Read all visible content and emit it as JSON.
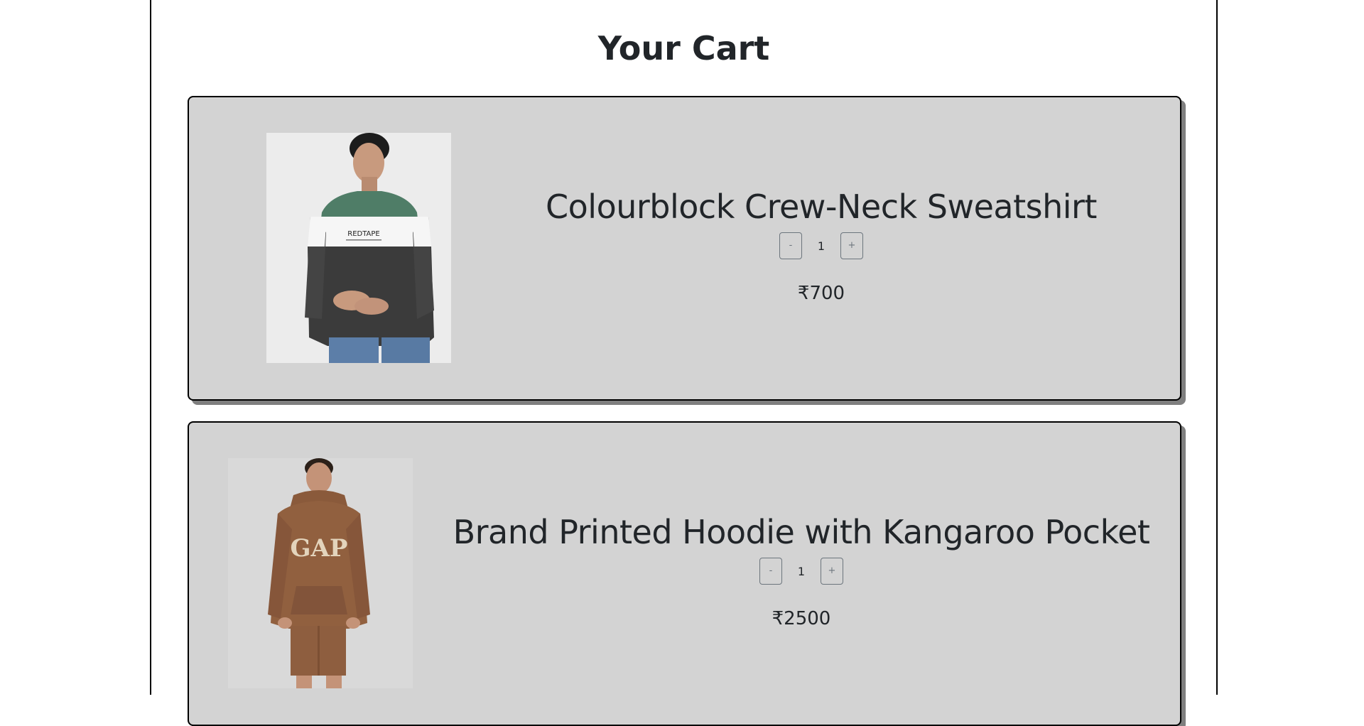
{
  "page": {
    "title": "Your Cart"
  },
  "cart": {
    "items": [
      {
        "name": "Colourblock Crew-Neck Sweatshirt",
        "image_icon": "sweatshirt-product-photo",
        "image_logo_text": "REDTAPE",
        "decrement_label": "-",
        "quantity": "1",
        "increment_label": "+",
        "price": "₹700"
      },
      {
        "name": "Brand Printed Hoodie with Kangaroo Pocket",
        "image_icon": "hoodie-product-photo",
        "image_logo_text": "GAP",
        "decrement_label": "-",
        "quantity": "1",
        "increment_label": "+",
        "price": "₹2500"
      }
    ]
  },
  "colors": {
    "card_background": "#d3d3d3",
    "card_border": "#000000",
    "card_shadow": "#7f7f7f",
    "button_outline": "#6c757d"
  }
}
